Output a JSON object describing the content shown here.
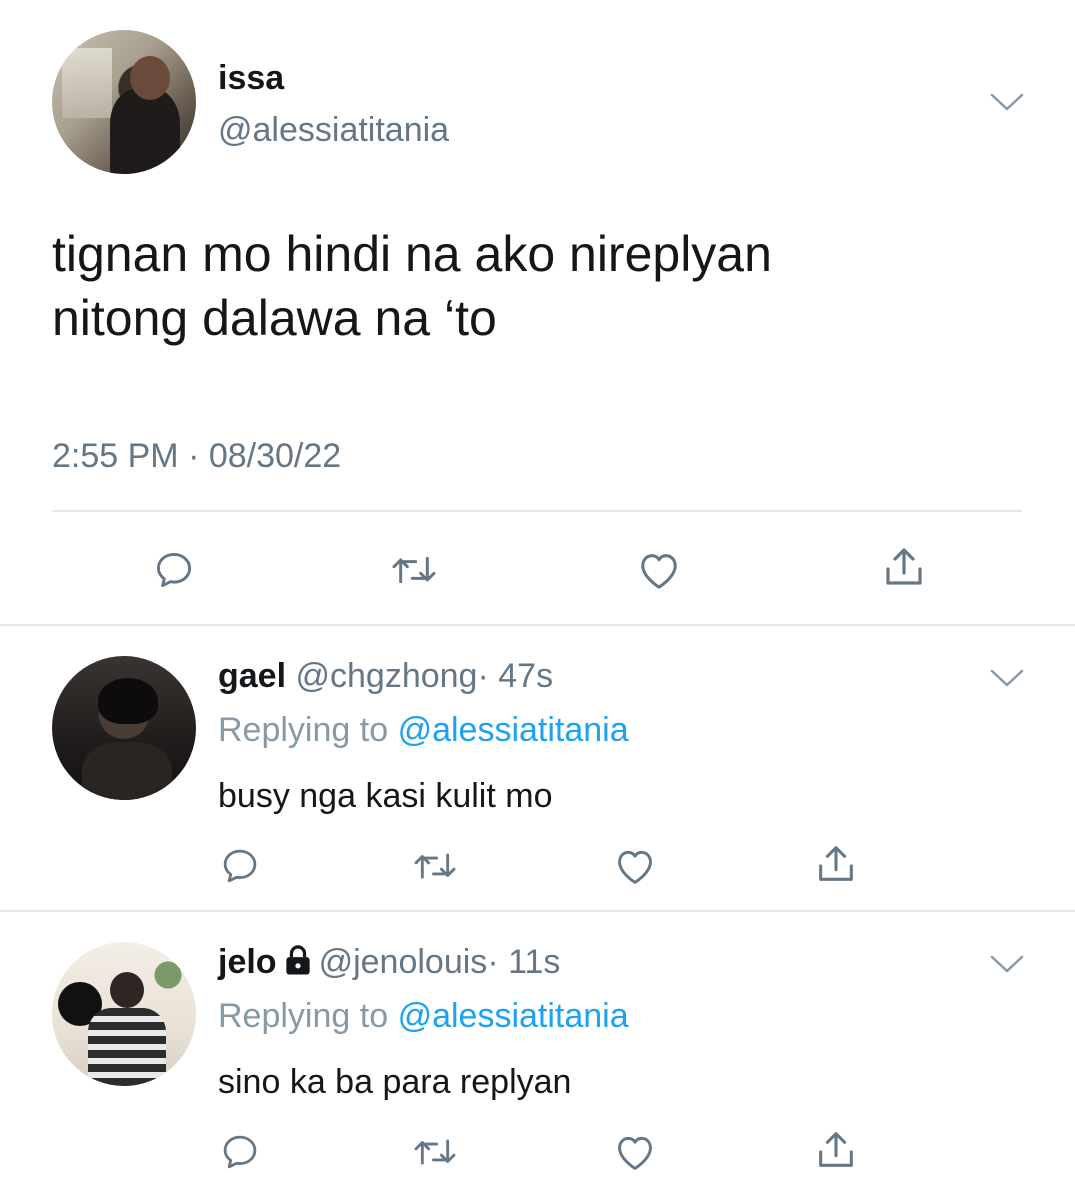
{
  "main_tweet": {
    "name": "issa",
    "handle": "@alessiatitania",
    "text_lines": [
      "tignan mo hindi na ako nireplyan",
      "nitong dalawa na ‘to"
    ],
    "timestamp": "2:55 PM · 08/30/22",
    "actions": [
      "reply-icon",
      "retweet-icon",
      "like-icon",
      "share-icon"
    ]
  },
  "replies": [
    {
      "name": "gael",
      "handle": "@chgzhong",
      "time": "· 47s",
      "replying_prefix": "Replying to",
      "replying_handle": "@alessiatitania",
      "text": "busy nga kasi kulit mo",
      "locked": false
    },
    {
      "name": "jelo",
      "handle": "@jenolouis",
      "time": "· 11s",
      "replying_prefix": "Replying to",
      "replying_handle": "@alessiatitania",
      "text": "sino ka ba para replyan",
      "locked": true
    }
  ],
  "colors": {
    "text": "#14171a",
    "secondary": "#657786",
    "link": "#1da1f2",
    "divider": "#e1e8ed",
    "icon": "#657786"
  }
}
